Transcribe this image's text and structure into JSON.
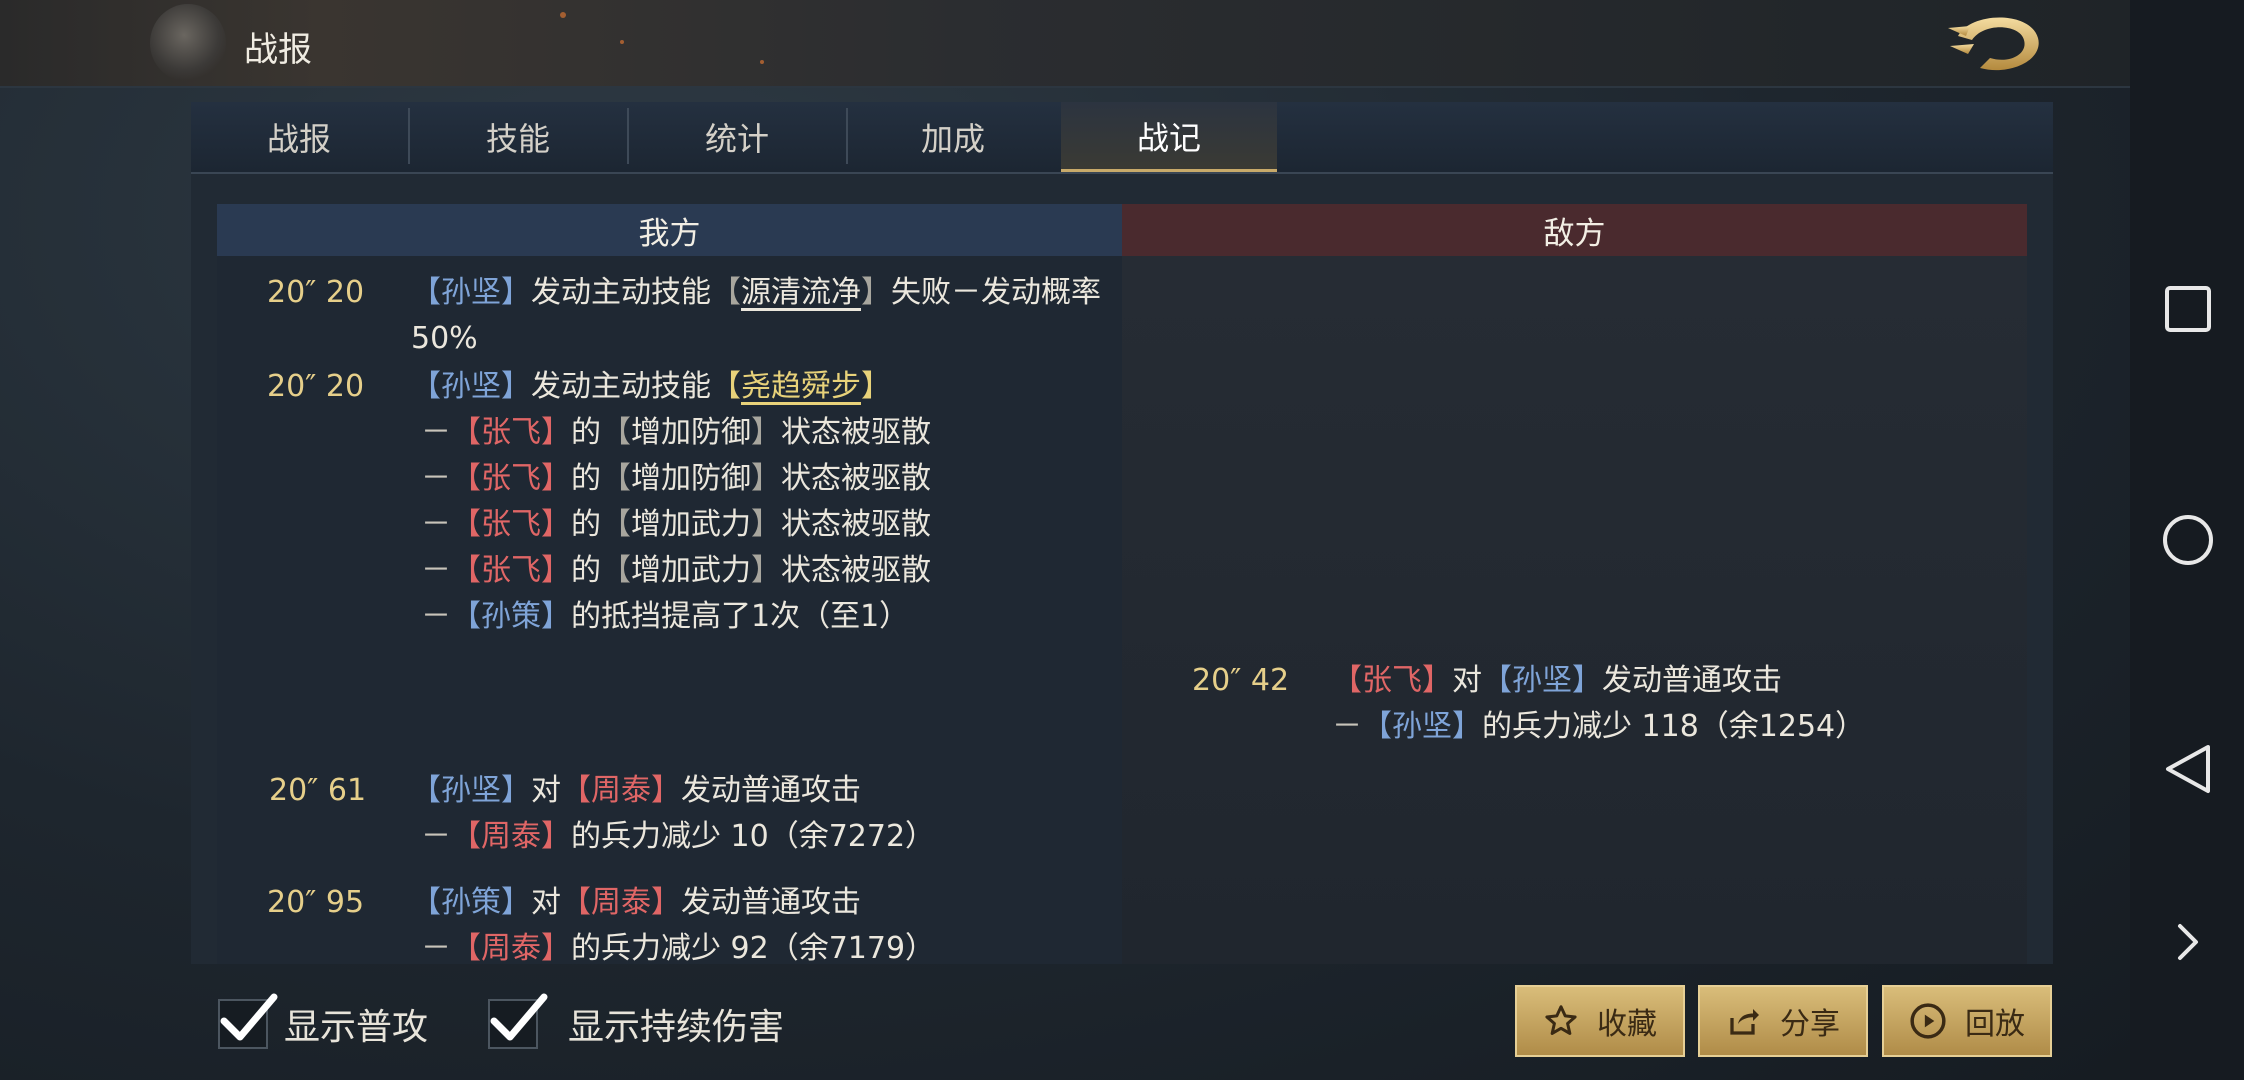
{
  "header": {
    "title": "战报"
  },
  "tabs": [
    {
      "label": "战报"
    },
    {
      "label": "技能"
    },
    {
      "label": "统计"
    },
    {
      "label": "加成"
    },
    {
      "label": "战记"
    }
  ],
  "active_tab": "战记",
  "columns": {
    "ours": "我方",
    "enemy": "敌方"
  },
  "log": {
    "e1": {
      "time": "20″ 20",
      "l1": {
        "b1": "【",
        "n": "孙坚",
        "b2": "】",
        "t": "发动主动技能",
        "b3": "【",
        "s": "源清流净",
        "b4": "】",
        "t2": "失败－发动概率"
      },
      "l2": "50%"
    },
    "e2": {
      "time": "20″ 20",
      "l1": {
        "b1": "【",
        "n": "孙坚",
        "b2": "】",
        "t": "发动主动技能",
        "b3": "【",
        "s": "尧趋舜步",
        "b4": "】"
      },
      "subs": [
        {
          "dash": "－",
          "b1": "【",
          "n": "张飞",
          "b2": "】",
          "t": "的",
          "b3": "【",
          "s": "增加防御",
          "b4": "】",
          "t2": "状态被驱散"
        },
        {
          "dash": "－",
          "b1": "【",
          "n": "张飞",
          "b2": "】",
          "t": "的",
          "b3": "【",
          "s": "增加防御",
          "b4": "】",
          "t2": "状态被驱散"
        },
        {
          "dash": "－",
          "b1": "【",
          "n": "张飞",
          "b2": "】",
          "t": "的",
          "b3": "【",
          "s": "增加武力",
          "b4": "】",
          "t2": "状态被驱散"
        },
        {
          "dash": "－",
          "b1": "【",
          "n": "张飞",
          "b2": "】",
          "t": "的",
          "b3": "【",
          "s": "增加武力",
          "b4": "】",
          "t2": "状态被驱散"
        },
        {
          "dash": "－",
          "b1": "【",
          "n": "孙策",
          "b2": "】",
          "t": "的抵挡提高了1次（至1）"
        }
      ]
    },
    "e3": {
      "time": "20″ 42",
      "l1": {
        "b1": "【",
        "n": "张飞",
        "b2": "】",
        "t": "对",
        "b3": "【",
        "n2": "孙坚",
        "b4": "】",
        "t2": "发动普通攻击"
      },
      "l2": {
        "dash": "－",
        "b1": "【",
        "n": "孙坚",
        "b2": "】",
        "t": "的兵力减少 118（余1254）"
      }
    },
    "e4": {
      "time": "20″ 61",
      "l1": {
        "b1": "【",
        "n": "孙坚",
        "b2": "】",
        "t": "对",
        "b3": "【",
        "n2": "周泰",
        "b4": "】",
        "t2": "发动普通攻击"
      },
      "l2": {
        "dash": "－",
        "b1": "【",
        "n": "周泰",
        "b2": "】",
        "t": "的兵力减少 10（余7272）"
      }
    },
    "e5": {
      "time": "20″ 95",
      "l1": {
        "b1": "【",
        "n": "孙策",
        "b2": "】",
        "t": "对",
        "b3": "【",
        "n2": "周泰",
        "b4": "】",
        "t2": "发动普通攻击"
      },
      "l2": {
        "dash": "－",
        "b1": "【",
        "n": "周泰",
        "b2": "】",
        "t": "的兵力减少 92（余7179）"
      }
    }
  },
  "footer": {
    "show_normal_attack": {
      "label": "显示普攻",
      "checked": true
    },
    "show_dot": {
      "label": "显示持续伤害",
      "checked": true
    },
    "favorite": "收藏",
    "share": "分享",
    "replay": "回放"
  },
  "colors": {
    "ally": "#7fa4d8",
    "foe": "#e06666",
    "time": "#e6cf8a",
    "gold": "#c8aa6a",
    "ours_header": "#2a3a52",
    "enemy_header": "#4a2a2e"
  },
  "icons": [
    "dragon-back-icon",
    "checkmark-icon",
    "star-icon",
    "share-icon",
    "play-circle-icon",
    "square-nav-icon",
    "circle-nav-icon",
    "triangle-back-nav-icon",
    "chevron-right-icon"
  ]
}
